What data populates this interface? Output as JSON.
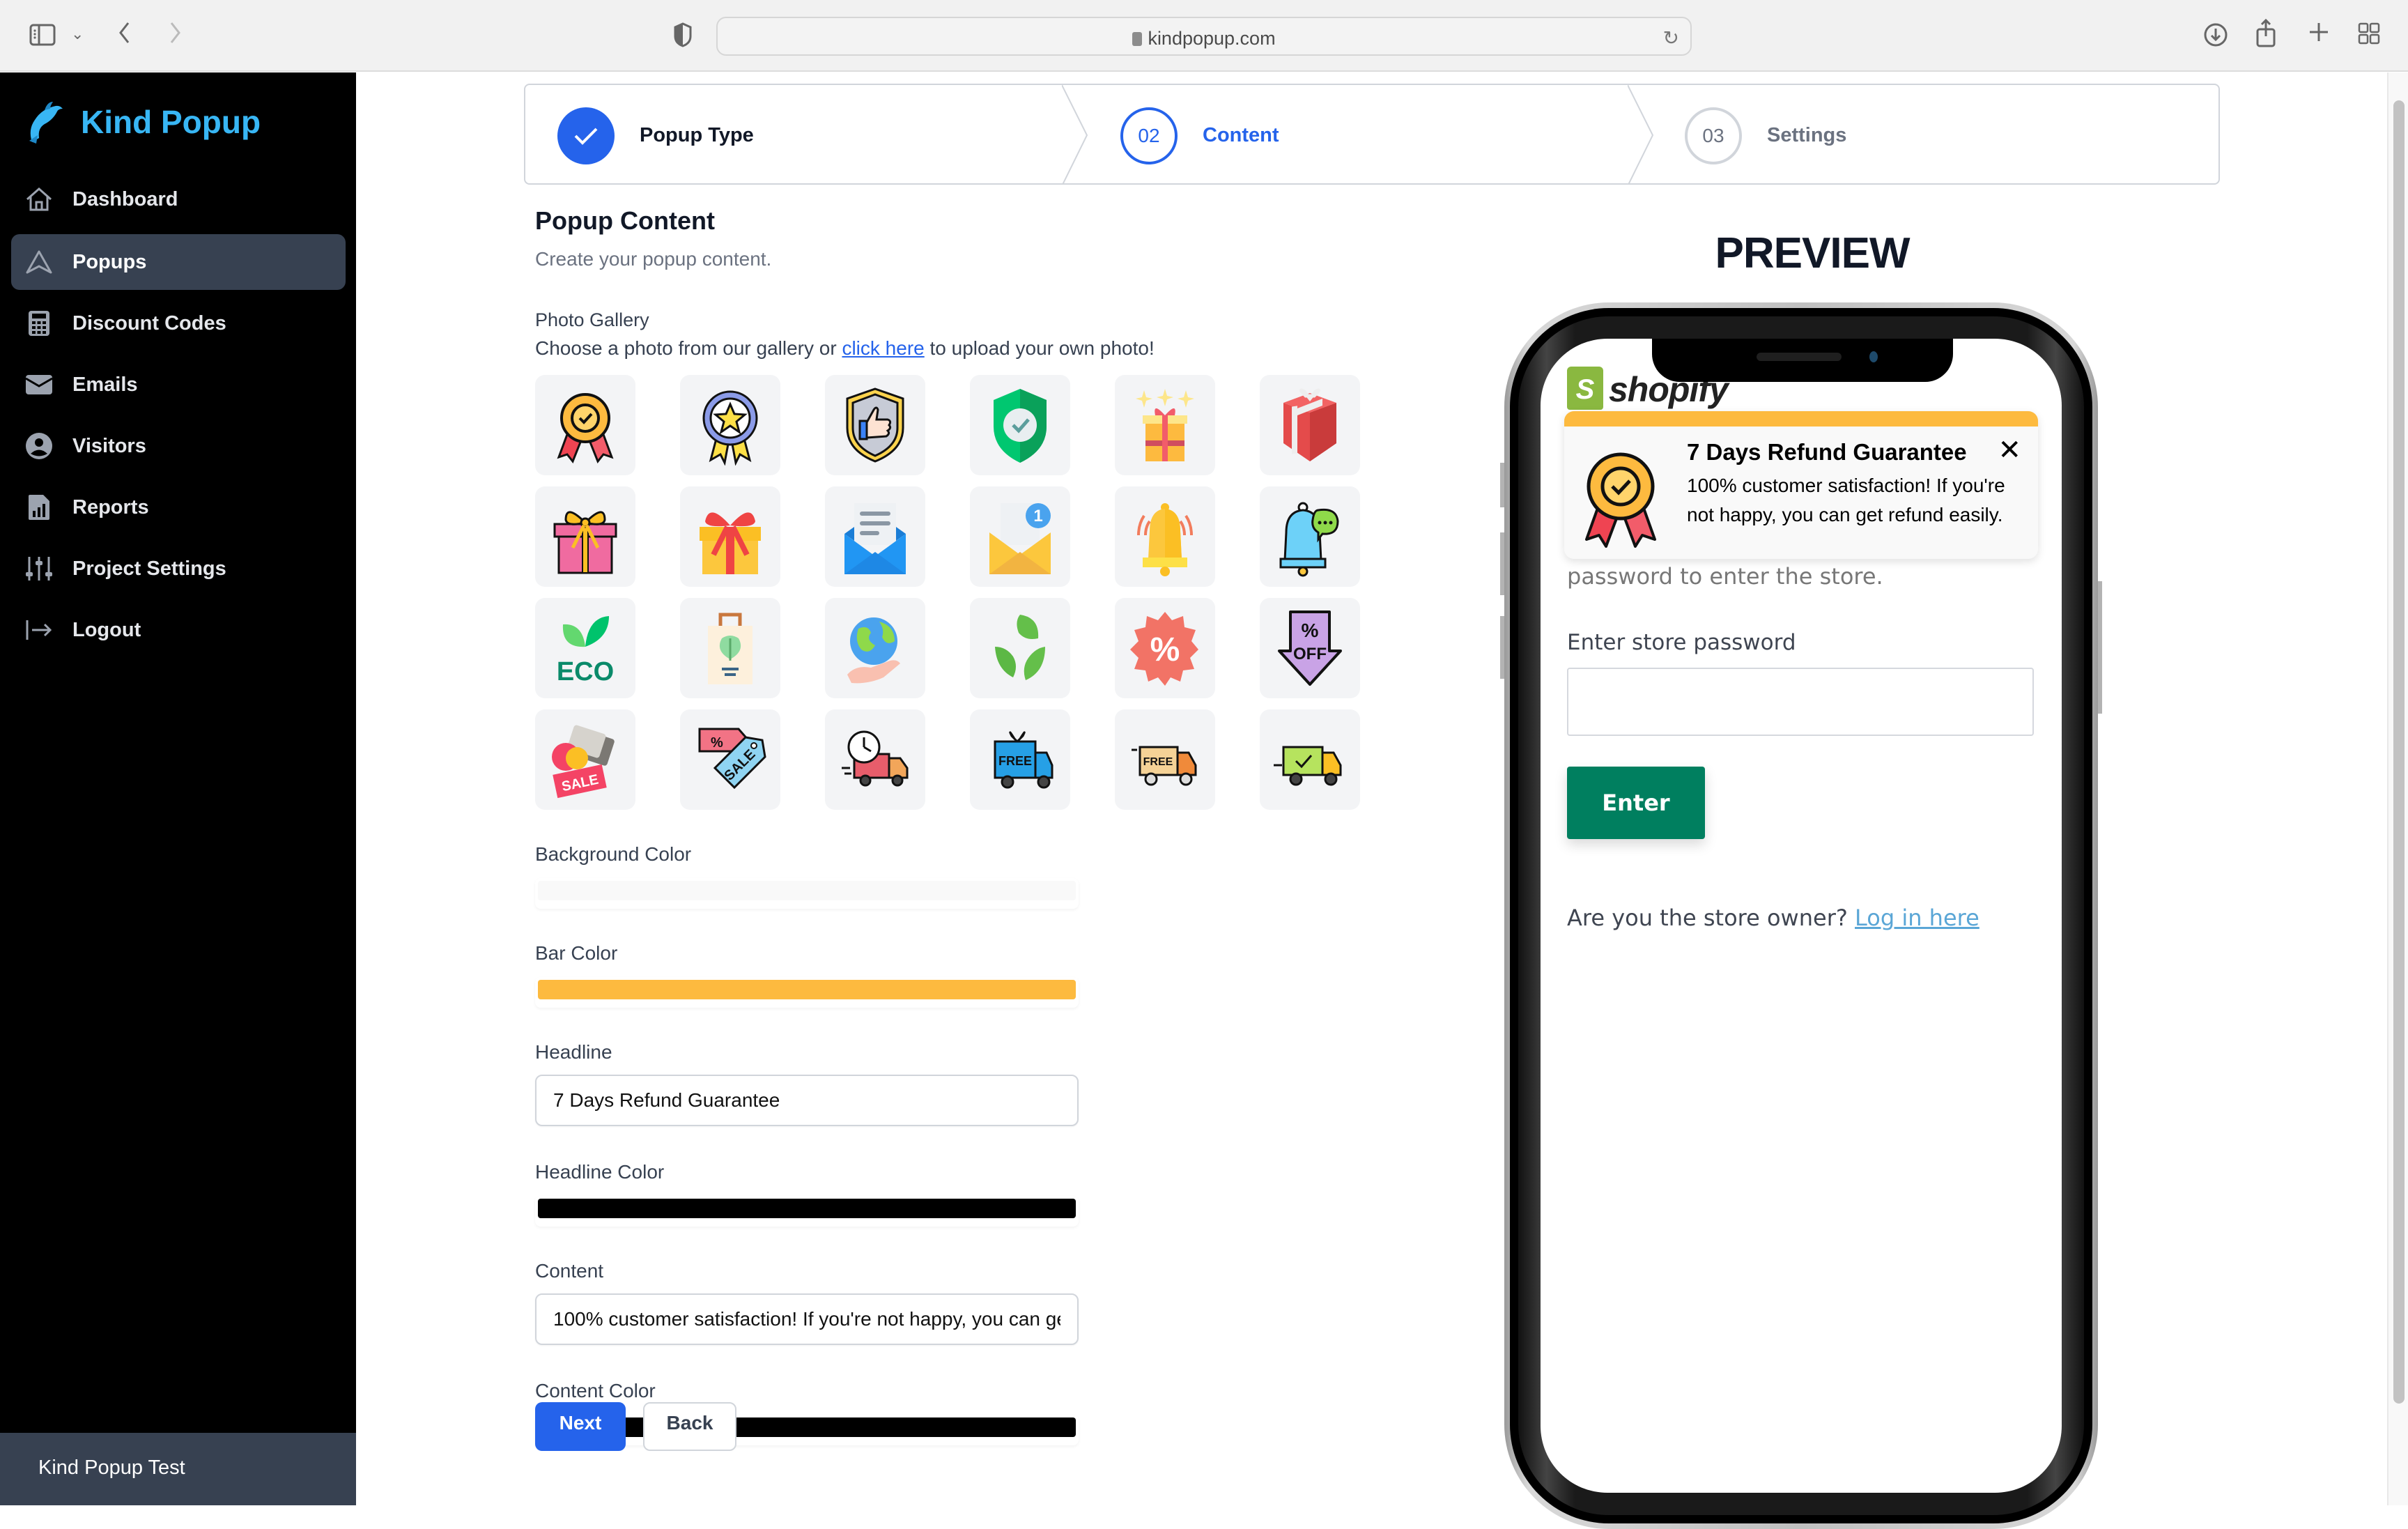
{
  "browser": {
    "url": "kindpopup.com",
    "icons": [
      "sidebar-toggle-icon",
      "chevron-down-icon",
      "back-icon",
      "forward-icon",
      "privacy-shield-icon",
      "lock-icon",
      "reload-icon",
      "download-icon",
      "share-icon",
      "new-tab-icon",
      "tab-overview-icon"
    ]
  },
  "sidebar": {
    "brand": "Kind Popup",
    "items": [
      {
        "label": "Dashboard",
        "icon": "home-icon",
        "active": false
      },
      {
        "label": "Popups",
        "icon": "popups-icon",
        "active": true
      },
      {
        "label": "Discount Codes",
        "icon": "calculator-icon",
        "active": false
      },
      {
        "label": "Emails",
        "icon": "mail-icon",
        "active": false
      },
      {
        "label": "Visitors",
        "icon": "user-circle-icon",
        "active": false
      },
      {
        "label": "Reports",
        "icon": "report-icon",
        "active": false
      },
      {
        "label": "Project Settings",
        "icon": "sliders-icon",
        "active": false
      },
      {
        "label": "Logout",
        "icon": "logout-icon",
        "active": false
      }
    ],
    "footer": "Kind Popup Test"
  },
  "stepper": {
    "steps": [
      {
        "number": "✓",
        "label": "Popup Type",
        "state": "complete"
      },
      {
        "number": "02",
        "label": "Content",
        "state": "current"
      },
      {
        "number": "03",
        "label": "Settings",
        "state": "upcoming"
      }
    ]
  },
  "content": {
    "title": "Popup Content",
    "subtitle": "Create your popup content.",
    "gallery_title": "Photo Gallery",
    "gallery_desc_before": "Choose a photo from our gallery or ",
    "gallery_link": "click here",
    "gallery_desc_after": " to upload your own photo!",
    "gallery": [
      "medal-check",
      "award-star",
      "shield-thumbs-up",
      "shield-check",
      "gift-sparkles",
      "gift-red",
      "gift-pink-bow",
      "gift-yellow-red-bow",
      "envelope-letter-blue",
      "envelope-notification",
      "bell-ringing",
      "bell-chat",
      "eco-leaf",
      "eco-bag",
      "earth-hand",
      "leaf-recycle",
      "discount-badge",
      "percent-off-arrow",
      "sale-tags-card",
      "sale-tag",
      "fast-delivery-truck",
      "free-gift-truck",
      "free-delivery-truck",
      "delivered-truck"
    ],
    "fields": {
      "background_color": {
        "label": "Background Color",
        "value": "#f9f9f9"
      },
      "bar_color": {
        "label": "Bar Color",
        "value": "#fdba3f"
      },
      "headline": {
        "label": "Headline",
        "value": "7 Days Refund Guarantee"
      },
      "headline_color": {
        "label": "Headline Color",
        "value": "#000000"
      },
      "content": {
        "label": "Content",
        "value": "100% customer satisfaction! If you're not happy, you can get refund easily."
      },
      "content_color": {
        "label": "Content Color",
        "value": "#000000"
      }
    },
    "next_label": "Next",
    "back_label": "Back"
  },
  "preview": {
    "title": "PREVIEW",
    "shop_brand": "shopify",
    "popup": {
      "headline": "7 Days Refund Guarantee",
      "body": "100% customer satisfaction! If you're not happy, you can get refund easily.",
      "close": "X"
    },
    "store_text": "password to enter the store.",
    "password_label": "Enter store password",
    "password_value": "",
    "enter_label": "Enter",
    "owner_text": "Are you the store owner? ",
    "owner_link": "Log in here"
  },
  "colors": {
    "accent": "#2563eb",
    "brand": "#38b6f4",
    "sidebar_bg": "#000000",
    "sidebar_active": "#374151",
    "enter_button": "#007f5f"
  }
}
